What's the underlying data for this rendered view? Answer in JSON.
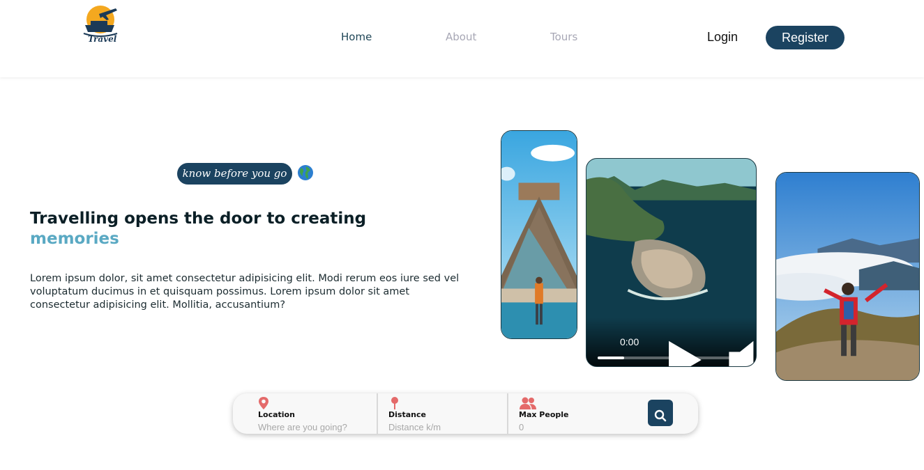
{
  "header": {
    "logo_text": "Travel",
    "nav": [
      {
        "label": "Home"
      },
      {
        "label": "About"
      },
      {
        "label": "Tours"
      }
    ],
    "login_label": "Login",
    "register_label": "Register"
  },
  "hero": {
    "tag": "know before you go",
    "title_line1": "Travelling opens the door to creating",
    "title_accent": "memories",
    "description": "Lorem ipsum dolor, sit amet consectetur adipisicing elit. Modi rerum eos iure sed vel voluptatum ducimus in et quisquam possimus. Lorem ipsum dolor sit amet consectetur adipisicing elit. Mollitia, accusantium?"
  },
  "video": {
    "time": "0:00",
    "progress": 0.18
  },
  "search": {
    "location": {
      "label": "Location",
      "placeholder": "Where are you going?"
    },
    "distance": {
      "label": "Distance",
      "placeholder": "Distance k/m"
    },
    "people": {
      "label": "Max People",
      "placeholder": "0"
    }
  },
  "colors": {
    "primary": "#1b4360",
    "accent": "#5aa9c3",
    "pin": "#e46a6a",
    "logo_sun": "#f4a81f"
  },
  "icons": [
    "logo-icon",
    "globe-icon",
    "play-icon",
    "volume-icon",
    "fullscreen-icon",
    "more-vertical-icon",
    "location-pin-icon",
    "distance-pin-icon",
    "people-icon",
    "search-icon"
  ]
}
